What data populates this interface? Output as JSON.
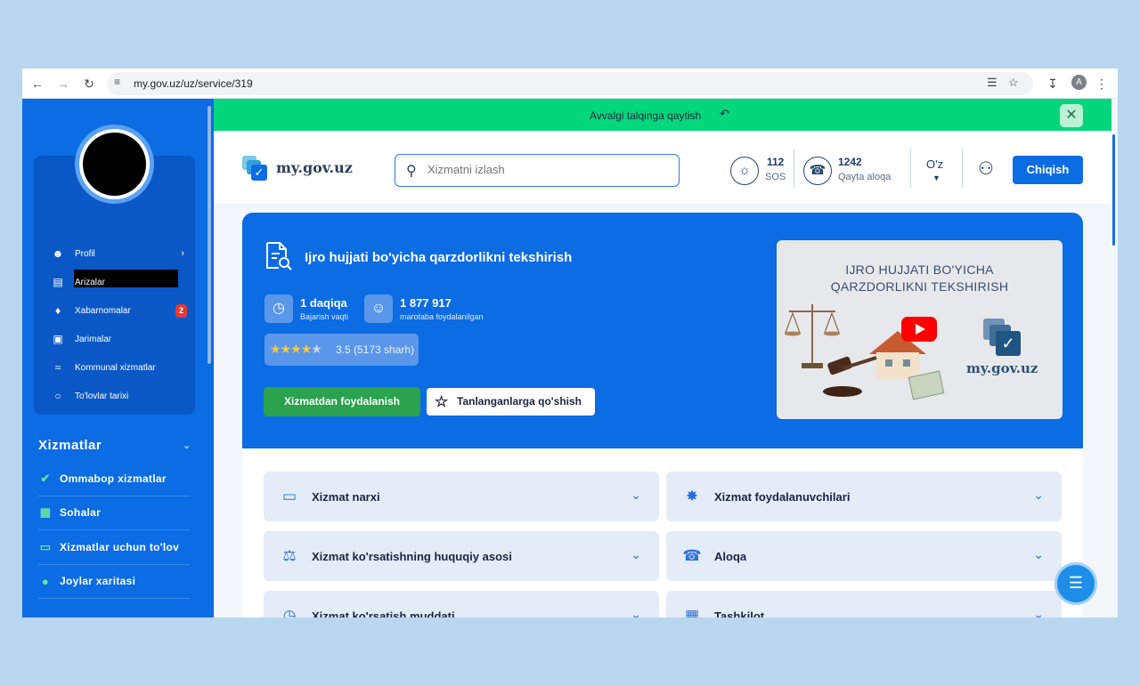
{
  "browser": {
    "url": "my.gov.uz/uz/service/319",
    "profile_initial": "A"
  },
  "sidebar": {
    "menu": [
      {
        "label": "Profil",
        "icon": "user-icon"
      },
      {
        "label": "Arizalar",
        "icon": "document-icon"
      },
      {
        "label": "Xabarnomalar",
        "icon": "bell-icon",
        "badge": "2"
      },
      {
        "label": "Jarimalar",
        "icon": "camera-icon"
      },
      {
        "label": "Kommunal xizmatlar",
        "icon": "utilities-icon"
      },
      {
        "label": "To'lovlar tarixi",
        "icon": "wallet-icon"
      }
    ],
    "services_title": "Xizmatlar",
    "services": [
      {
        "label": "Ommabop xizmatlar",
        "icon": "badge-check-icon"
      },
      {
        "label": "Sohalar",
        "icon": "grid-icon"
      },
      {
        "label": "Xizmatlar uchun to'lov",
        "icon": "card-icon"
      },
      {
        "label": "Joylar xaritasi",
        "icon": "map-pin-icon"
      }
    ]
  },
  "back_bar": {
    "label": "Avvalgi talqinga qaytish"
  },
  "header": {
    "logo_text": "my.gov.uz",
    "search_placeholder": "Xizmatni izlash",
    "sos_number": "112",
    "sos_label": "SOS",
    "callback_number": "1242",
    "callback_label": "Qayta aloqa",
    "language": "O'z",
    "logout_label": "Chiqish"
  },
  "service": {
    "title": "Ijro hujjati bo'yicha qarzdorlikni tekshirish",
    "duration_value": "1 daqiqa",
    "duration_label": "Bajarish vaqti",
    "usage_value": "1 877 917",
    "usage_label": "marotaba foydalanilgan",
    "rating": 3.5,
    "rating_text": "3.5 (5173 sharh)",
    "use_button": "Xizmatdan foydalanish",
    "favorite_button": "Tanlanganlarga qo'shish",
    "video_title_line1": "IJRO HUJJATI BO'YICHA",
    "video_title_line2": "QARZDORLIKNI TEKSHIRISH",
    "video_logo_text": "my.gov.uz"
  },
  "accordion": [
    {
      "label": "Xizmat narxi",
      "icon": "card-icon"
    },
    {
      "label": "Xizmat foydalanuvchilari",
      "icon": "person-icon"
    },
    {
      "label": "Xizmat ko'rsatishning huquqiy asosi",
      "icon": "scales-icon"
    },
    {
      "label": "Aloqa",
      "icon": "phone-icon"
    },
    {
      "label": "Xizmat ko'rsatish muddati",
      "icon": "clock-icon"
    },
    {
      "label": "Tashkilot",
      "icon": "building-icon"
    }
  ],
  "colors": {
    "primary": "#0b6ce4",
    "success": "#04d67e",
    "button_green": "#2aa24e",
    "badge_red": "#e53935"
  }
}
